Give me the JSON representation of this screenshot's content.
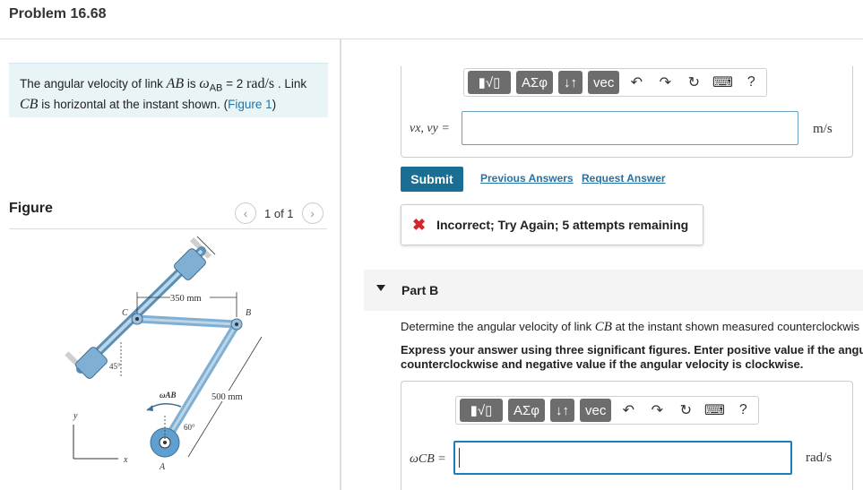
{
  "header": {
    "title": "Problem 16.68"
  },
  "problem": {
    "text_1": "The angular velocity of link ",
    "link_ab": "AB",
    "text_2": " is ",
    "omega_ab": "ω",
    "omega_ab_sub": "AB",
    "equals_value": " = 2 ",
    "unit": "rad/s",
    "text_3": " . Link",
    "link_cb": "CB",
    "text_4": " is horizontal at the instant shown. (",
    "figure_link": "Figure 1",
    "text_5": ")"
  },
  "figure": {
    "label": "Figure",
    "count": "1 of 1",
    "prev_glyph": "‹",
    "next_glyph": "›",
    "labels": {
      "dim_350": "350 mm",
      "dim_500": "500 mm",
      "angle_45": "45°",
      "angle_60": "60°",
      "point_a": "A",
      "point_b": "B",
      "point_c": "C",
      "omega": "ωAB",
      "axis_x": "x",
      "axis_y": "y"
    }
  },
  "toolbar": {
    "template_glyph": "▮√▯",
    "greek": "ΑΣφ",
    "arrows": "↓↑",
    "vec": "vec",
    "undo": "↶",
    "redo": "↷",
    "reset": "↻",
    "keyboard": "⌨",
    "help": "?"
  },
  "part_a": {
    "var_label": "vx, vy =",
    "input_value": "",
    "unit": "m/s",
    "submit_label": "Submit",
    "prev_answers": "Previous Answers",
    "request_answer": "Request Answer",
    "feedback": "Incorrect; Try Again; 5 attempts remaining",
    "feedback_icon": "✖"
  },
  "part_b": {
    "title": "Part B",
    "question_1": "Determine the angular velocity of link ",
    "question_link": "CB",
    "question_2": " at the instant shown measured counterclockwis",
    "instruction_line1": "Express your answer using three significant figures. Enter positive value if the angu",
    "instruction_line2": "counterclockwise and negative value if the angular velocity is clockwise.",
    "var_label": "ωCB =",
    "input_value": "",
    "unit": "rad/s"
  },
  "colors": {
    "accent": "#1a6d93",
    "link": "#2673a6",
    "problem_bg": "#e8f4f6",
    "error": "#d0262e",
    "link_fill": "#a9c9de"
  }
}
